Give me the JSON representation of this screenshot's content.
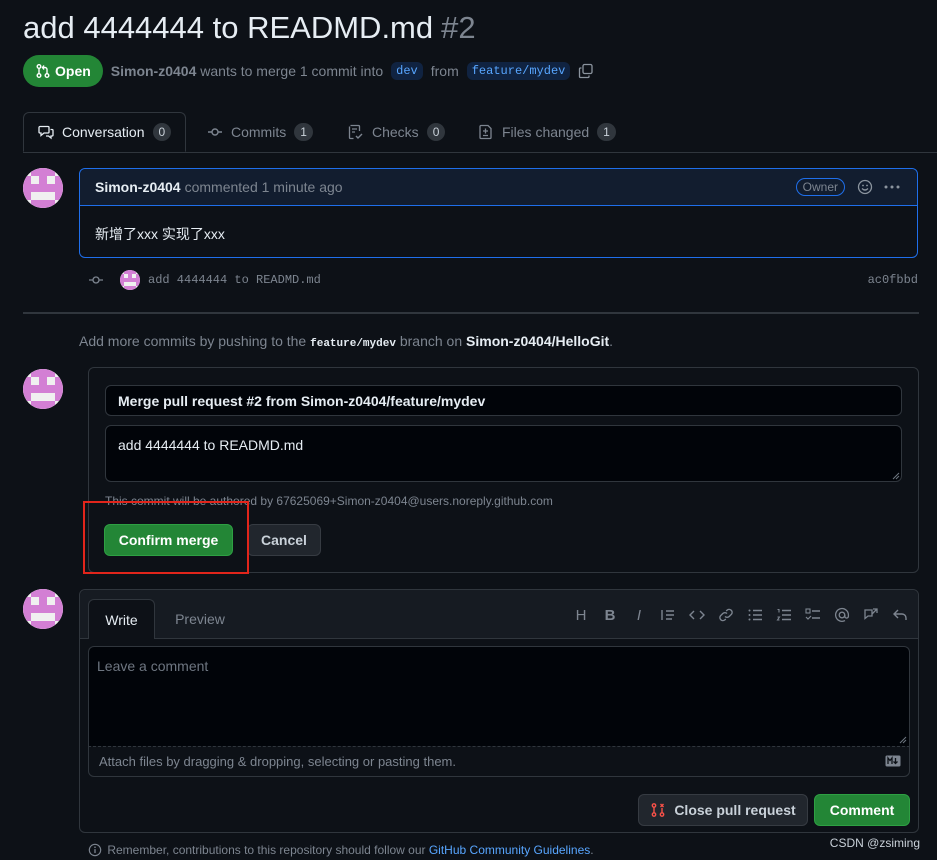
{
  "pr": {
    "title": "add 4444444 to READMD.md",
    "number": "#2",
    "state": "Open",
    "author": "Simon-z0404",
    "merge_text": "wants to merge 1 commit into",
    "base_branch": "dev",
    "from_text": "from",
    "head_branch": "feature/mydev"
  },
  "tabs": [
    {
      "label": "Conversation",
      "count": "0",
      "icon": "conversation-icon"
    },
    {
      "label": "Commits",
      "count": "1",
      "icon": "commit-icon"
    },
    {
      "label": "Checks",
      "count": "0",
      "icon": "checklist-icon"
    },
    {
      "label": "Files changed",
      "count": "1",
      "icon": "file-diff-icon"
    }
  ],
  "comment": {
    "author": "Simon-z0404",
    "action": "commented 1 minute ago",
    "badge": "Owner",
    "body": "新增了xxx 实现了xxx"
  },
  "commit": {
    "message": "add 4444444 to READMD.md",
    "sha": "ac0fbbd"
  },
  "hint": {
    "prefix": "Add more commits by pushing to the",
    "branch": "feature/mydev",
    "middle": "branch on",
    "repo": "Simon-z0404/HelloGit",
    "suffix": "."
  },
  "merge": {
    "title_value": "Merge pull request #2 from Simon-z0404/feature/mydev",
    "body_value": "add 4444444 to READMD.md",
    "authored_note": "This commit will be authored by 67625069+Simon-z0404@users.noreply.github.com",
    "confirm_label": "Confirm merge",
    "cancel_label": "Cancel"
  },
  "editor": {
    "write_tab": "Write",
    "preview_tab": "Preview",
    "placeholder": "Leave a comment",
    "attach_text": "Attach files by dragging & dropping, selecting or pasting them.",
    "close_label": "Close pull request",
    "comment_label": "Comment"
  },
  "footer": {
    "text": "Remember, contributions to this repository should follow our",
    "link": "GitHub Community Guidelines",
    "suffix": "."
  },
  "watermark": "CSDN @zsiming",
  "colors": {
    "accent": "#238636",
    "link": "#58a6ff",
    "highlight": "#e1251b"
  }
}
